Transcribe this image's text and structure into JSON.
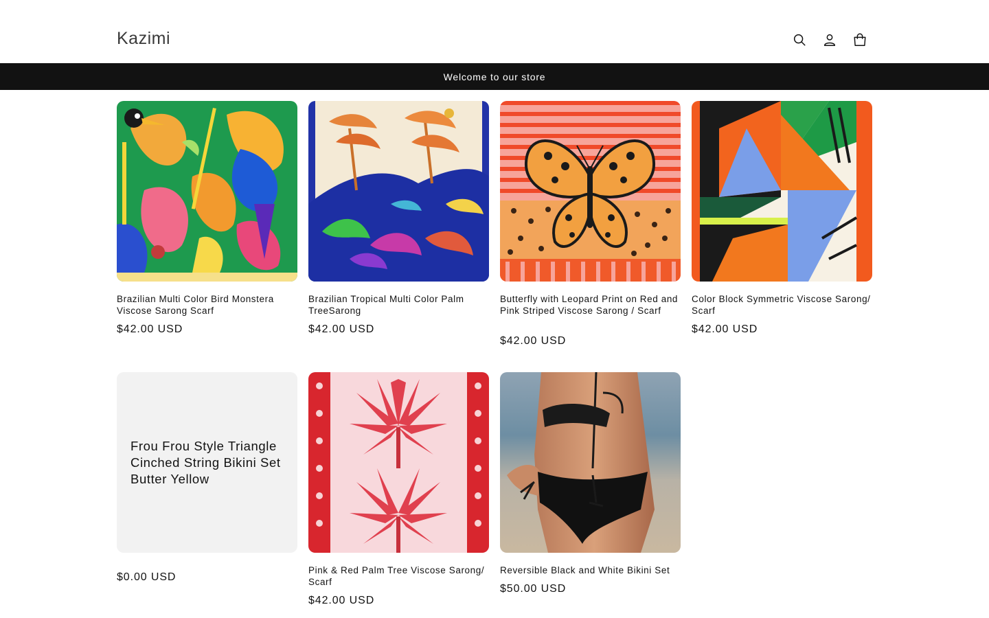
{
  "header": {
    "logo": "Kazimi",
    "icons": [
      "search-icon",
      "account-icon",
      "cart-icon"
    ]
  },
  "announcement": "Welcome to our store",
  "products": [
    {
      "title": "Brazilian Multi Color Bird Monstera Viscose Sarong Scarf",
      "price": "$42.00 USD"
    },
    {
      "title": "Brazilian Tropical Multi Color Palm TreeSarong",
      "price": "$42.00 USD"
    },
    {
      "title": "Butterfly with Leopard Print on Red and Pink Striped Viscose Sarong / Scarf",
      "price": "$42.00 USD"
    },
    {
      "title": "Color Block Symmetric Viscose Sarong/ Scarf",
      "price": "$42.00 USD"
    },
    {
      "title": "Frou Frou Style Triangle Cinched String Bikini Set Butter Yellow",
      "price": "$0.00 USD"
    },
    {
      "title": "Pink & Red Palm Tree Viscose Sarong/ Scarf",
      "price": "$42.00 USD"
    },
    {
      "title": "Reversible Black and White Bikini Set",
      "price": "$50.00 USD"
    }
  ],
  "colors": {
    "announcement_bg": "#121212",
    "placeholder_bg": "#f2f2f2",
    "text": "#121212"
  }
}
